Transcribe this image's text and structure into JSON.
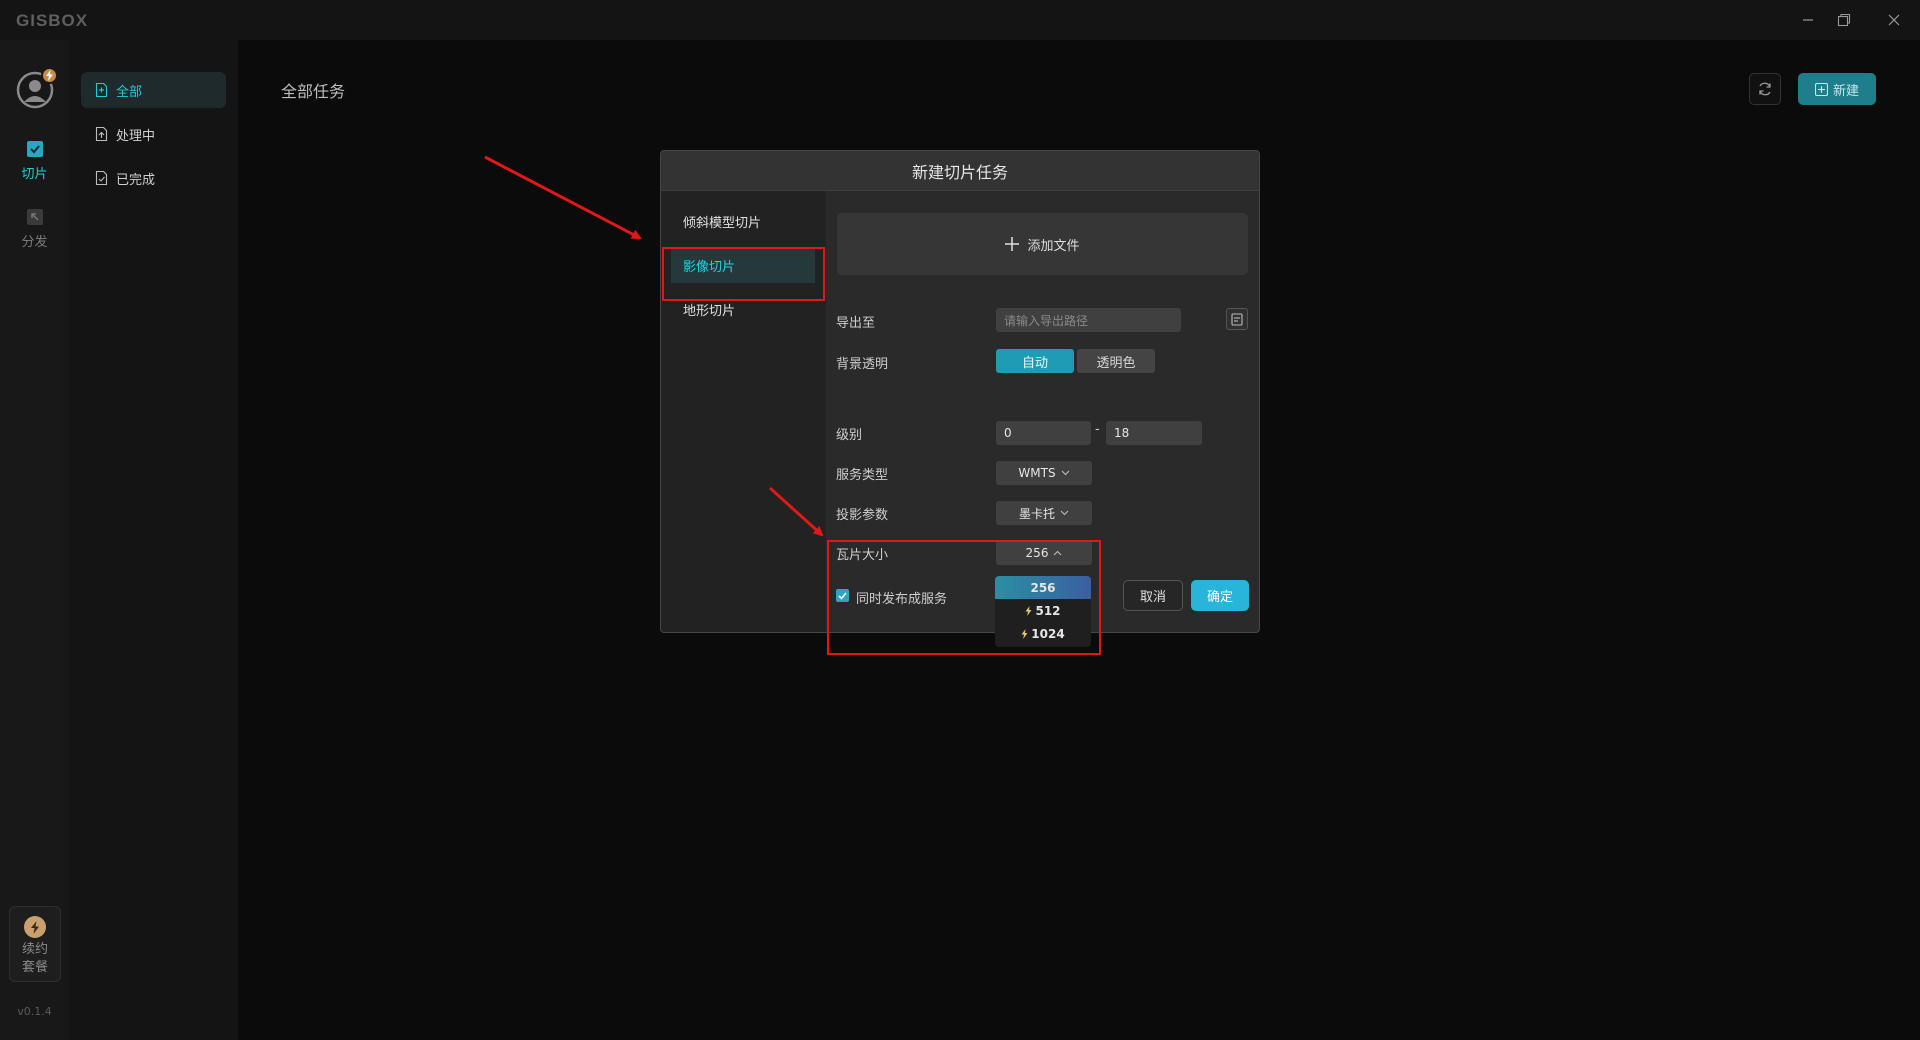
{
  "app": {
    "brand": "GISBOX",
    "version": "v0.1.4"
  },
  "rail": {
    "items": [
      {
        "label": "切片",
        "icon": "slice-icon"
      },
      {
        "label": "分发",
        "icon": "distribute-icon"
      }
    ],
    "renew": {
      "label": "续约套餐",
      "icon": "lightning-icon"
    }
  },
  "sidebar": {
    "items": [
      {
        "label": "全部",
        "icon": "file-icon",
        "active": true
      },
      {
        "label": "处理中",
        "icon": "file-upload-icon",
        "active": false
      },
      {
        "label": "已完成",
        "icon": "file-check-icon",
        "active": false
      }
    ]
  },
  "main": {
    "title": "全部任务",
    "new_label": "新建"
  },
  "dialog": {
    "title": "新建切片任务",
    "tabs": [
      "倾斜模型切片",
      "影像切片",
      "地形切片"
    ],
    "active_tab": 1,
    "add_file_label": "添加文件",
    "fields": {
      "export_label": "导出至",
      "export_placeholder": "请输入导出路径",
      "bg_label": "背景透明",
      "bg_options": [
        "自动",
        "透明色"
      ],
      "level_label": "级别",
      "level_min": "0",
      "level_dash": "-",
      "level_max": "18",
      "service_label": "服务类型",
      "service_value": "WMTS",
      "projection_label": "投影参数",
      "projection_value": "墨卡托",
      "tile_label": "瓦片大小",
      "tile_value": "256",
      "publish_label": "同时发布成服务",
      "publish_checked": true
    },
    "tile_options": [
      "256",
      "512",
      "1024"
    ],
    "cancel_label": "取消",
    "ok_label": "确定"
  },
  "colors": {
    "accent": "#29b5d9",
    "active_text": "#2cc7d6",
    "annotation": "#e01818"
  }
}
